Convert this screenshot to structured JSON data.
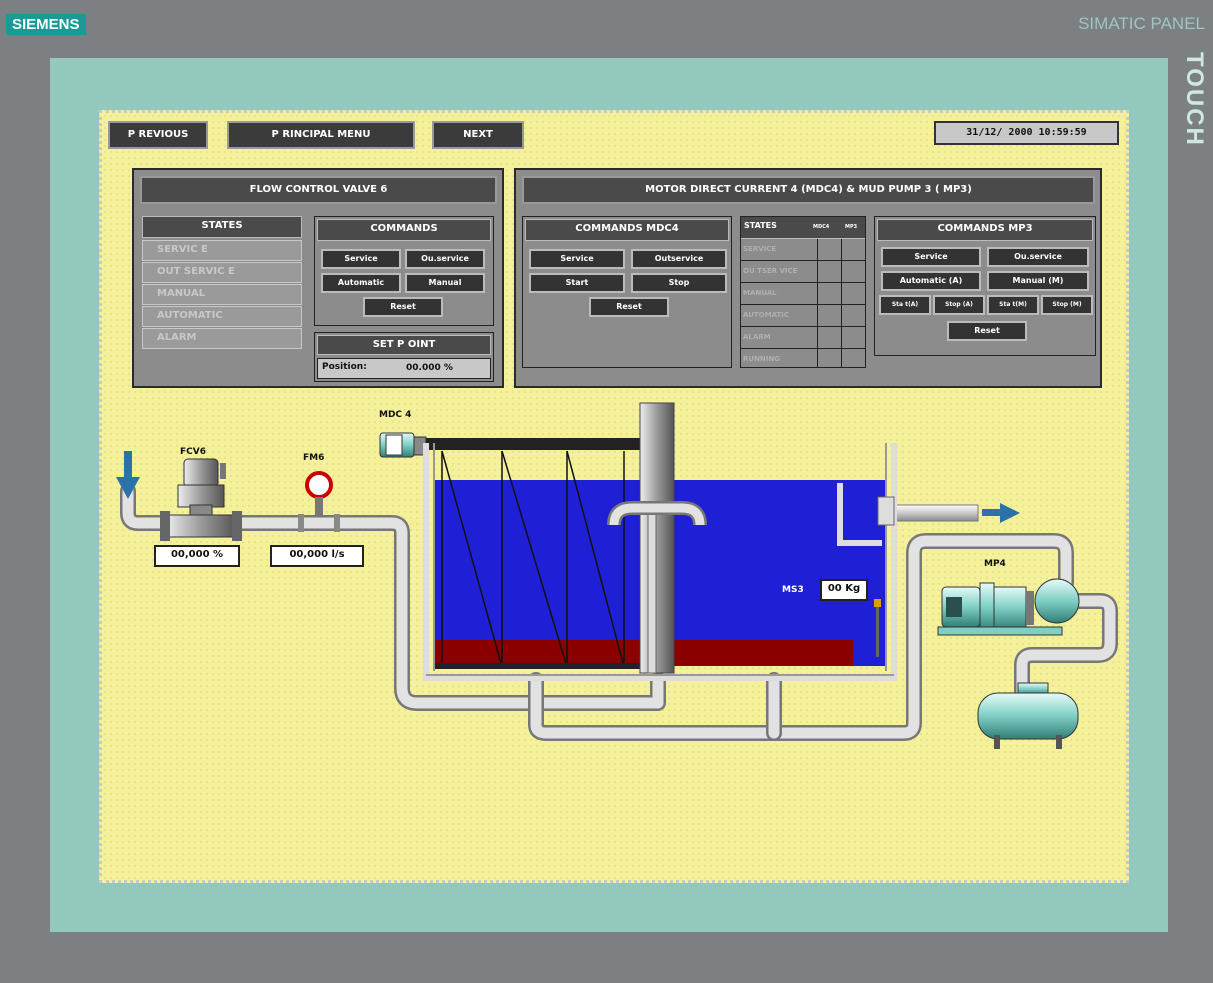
{
  "brand": "SIEMENS",
  "panel_title": "SIMATIC PANEL",
  "touch_label": "TOUCH",
  "nav": {
    "previous": "P REVIOUS",
    "principal_menu": "P RINCIPAL MENU",
    "next": "NEXT"
  },
  "clock": "31/12/ 2000 10:59:59",
  "fcv": {
    "title": "FLOW CONTROL VALVE 6",
    "states_title": "STATES",
    "states": [
      "SERVIC E",
      "OUT SERVIC E",
      "MANUAL",
      "AUTOMATIC",
      "ALARM"
    ],
    "commands_title": "COMMANDS",
    "commands": {
      "service": "Service",
      "out_service": "Ou.service",
      "automatic": "Automatic",
      "manual": "Manual",
      "reset": "Reset"
    },
    "setpoint_title": "SET P OINT",
    "position_label": "Position:",
    "position_value": "00.000 %"
  },
  "mdc": {
    "title": "MOTOR DIRECT CURRENT 4 (MDC4) & MUD PUMP 3 ( MP3)",
    "commands_mdc_title": "COMMANDS MDC4",
    "commands_mdc": {
      "service": "Service",
      "out_service": "Outservice",
      "start": "Start",
      "stop": "Stop",
      "reset": "Reset"
    },
    "states_title": "STATES",
    "states_col1": "MDC4",
    "states_col2": "MP3",
    "states": [
      "SERVICE",
      "OU TSER VICE",
      "MANUAL",
      "AUTOMATIC",
      "ALARM",
      "RUNNING"
    ],
    "commands_mp_title": "COMMANDS MP3",
    "commands_mp": {
      "service": "Service",
      "out_service": "Ou.service",
      "automatic": "Automatic (A)",
      "manual": "Manual (M)",
      "sta_a": "Sta t(A)",
      "stop_a": "Stop (A)",
      "sta_m": "Sta t(M)",
      "stop_m": "Stop (M)",
      "reset": "Reset"
    }
  },
  "process": {
    "fcv_label": "FCV6",
    "fcv_value": "00,000 %",
    "fm_label": "FM6",
    "fm_value": "00,000 l/s",
    "mdc_label": "MDC 4",
    "ms_label": "MS3",
    "ms_value": "00 Kg",
    "mp_label": "MP4"
  },
  "colors": {
    "water": "#1f1fd6",
    "sludge": "#8a0000",
    "screen_bg": "#f4f19a",
    "bezel": "#93c8bd",
    "pipe": "#d8d8d8",
    "arrow": "#2a73a8"
  }
}
